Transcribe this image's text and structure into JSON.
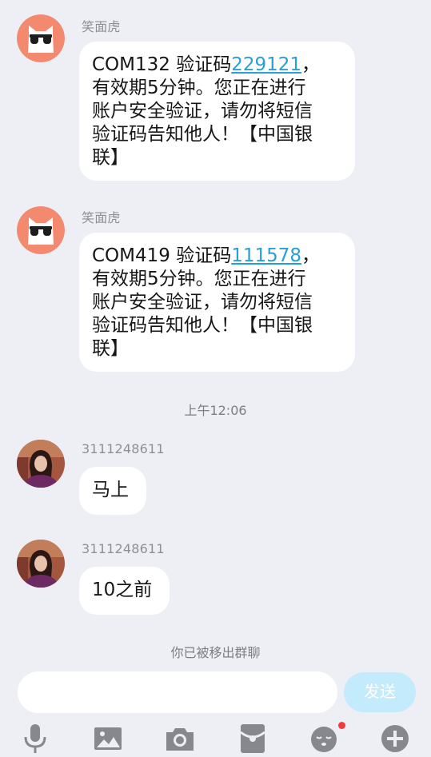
{
  "messages": [
    {
      "sender": "笑面虎",
      "lines": [
        "COM132 验证码",
        "229121",
        "，",
        "有效期5分钟。您正在进行",
        "账户安全验证，请勿将短信",
        "验证码告知他人！【中国银",
        "联】"
      ],
      "prefix": "COM132 验证码",
      "code": "229121",
      "line1_suffix": "，",
      "line2": "有效期5分钟。您正在进行",
      "line3": "账户安全验证，请勿将短信",
      "line4": "验证码告知他人！【中国银",
      "line5": "联】"
    },
    {
      "sender": "笑面虎",
      "prefix": "COM419 验证码",
      "code": "111578",
      "line1_suffix": "，",
      "line2": "有效期5分钟。您正在进行",
      "line3": "账户安全验证，请勿将短信",
      "line4": "验证码告知他人！【中国银",
      "line5": "联】"
    },
    {
      "sender": "3111248611",
      "text": "马上"
    },
    {
      "sender": "3111248611",
      "text": "10之前"
    }
  ],
  "timestamp": "上午12:06",
  "system_note": "你已被移出群聊",
  "input": {
    "placeholder": ""
  },
  "send_label": "发送",
  "toolbar_icons": [
    "microphone-icon",
    "image-icon",
    "camera-icon",
    "red-packet-icon",
    "emoji-icon",
    "plus-icon"
  ],
  "colors": {
    "background": "#edeff5",
    "bubble": "#ffffff",
    "link": "#2a9fd6",
    "send_button": "#c4ebfb",
    "tiger_avatar": "#f38a70",
    "notification_dot": "#f23b3b"
  }
}
